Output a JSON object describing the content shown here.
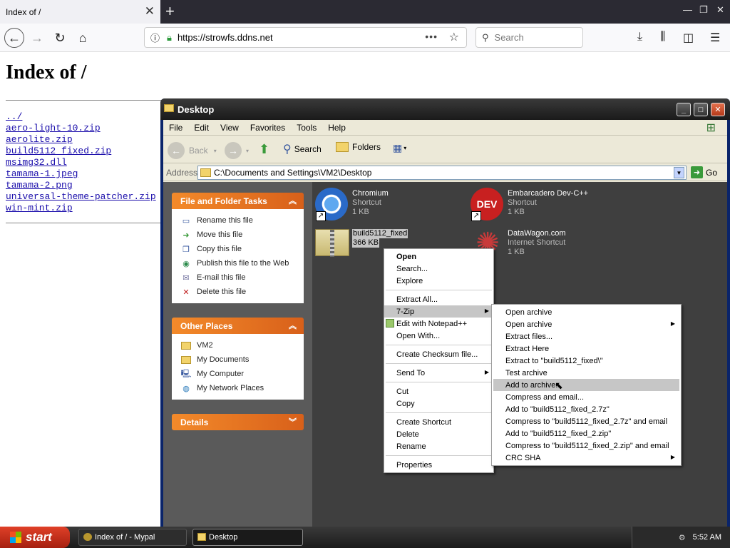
{
  "browser": {
    "tab_title": "Index of /",
    "url": "https://strowfs.ddns.net",
    "search_placeholder": "Search"
  },
  "page": {
    "title": "Index of /",
    "files": [
      "../",
      "aero-light-10.zip",
      "aerolite.zip",
      "build5112 fixed.zip",
      "msimg32.dll",
      "tamama-1.jpeg",
      "tamama-2.png",
      "universal-theme-patcher.zip",
      "win-mint.zip"
    ]
  },
  "explorer": {
    "title": "Desktop",
    "menu": [
      "File",
      "Edit",
      "View",
      "Favorites",
      "Tools",
      "Help"
    ],
    "toolbar": {
      "back": "Back",
      "search": "Search",
      "folders": "Folders"
    },
    "address_label": "Address",
    "address_value": "C:\\Documents and Settings\\VM2\\Desktop",
    "go_label": "Go",
    "tasks_header": "File and Folder Tasks",
    "tasks": [
      "Rename this file",
      "Move this file",
      "Copy this file",
      "Publish this file to the Web",
      "E-mail this file",
      "Delete this file"
    ],
    "places_header": "Other Places",
    "places": [
      "VM2",
      "My Documents",
      "My Computer",
      "My Network Places"
    ],
    "details_header": "Details",
    "items": [
      {
        "name": "Chromium",
        "type": "Shortcut",
        "size": "1 KB"
      },
      {
        "name": "Embarcadero Dev-C++",
        "type": "Shortcut",
        "size": "1 KB"
      },
      {
        "name": "build5112_fixed",
        "size": "366 KB"
      },
      {
        "name": "DataWagon.com",
        "type": "Internet Shortcut",
        "size": "1 KB"
      }
    ]
  },
  "context_menu": {
    "items": [
      "Open",
      "Search...",
      "Explore",
      "Extract All...",
      "7-Zip",
      "Edit with Notepad++",
      "Open With...",
      "Create Checksum file...",
      "Send To",
      "Cut",
      "Copy",
      "Create Shortcut",
      "Delete",
      "Rename",
      "Properties"
    ]
  },
  "sevenzip_menu": {
    "items": [
      "Open archive",
      "Open archive",
      "Extract files...",
      "Extract Here",
      "Extract to \"build5112_fixed\\\"",
      "Test archive",
      "Add to archive...",
      "Compress and email...",
      "Add to \"build5112_fixed_2.7z\"",
      "Compress to \"build5112_fixed_2.7z\" and email",
      "Add to \"build5112_fixed_2.zip\"",
      "Compress to \"build5112_fixed_2.zip\" and email",
      "CRC SHA"
    ]
  },
  "taskbar": {
    "start": "start",
    "tasks": [
      "Index of / - Mypal",
      "Desktop"
    ],
    "clock": "5:52 AM"
  }
}
